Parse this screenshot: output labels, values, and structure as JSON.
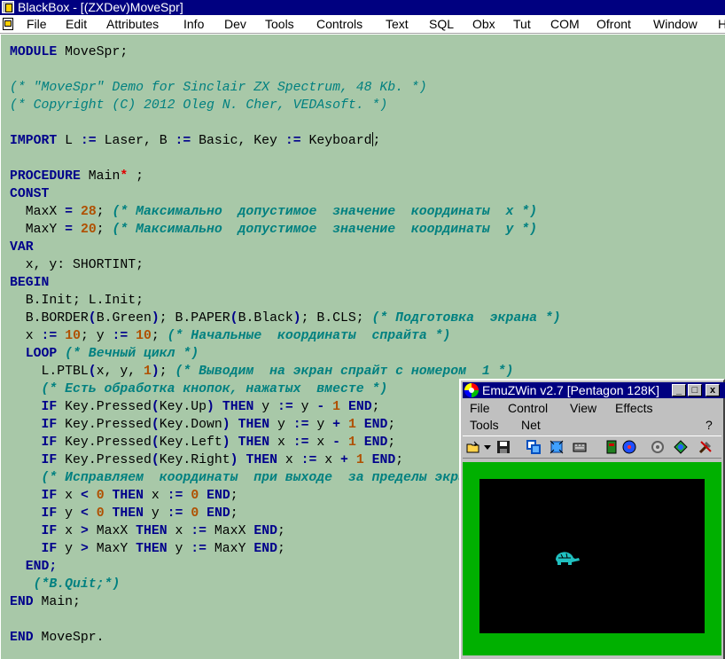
{
  "window": {
    "title": "BlackBox - [(ZXDev)MoveSpr]"
  },
  "menu": [
    "File",
    "Edit",
    "Attributes",
    "Info",
    "Dev",
    "Tools",
    "Controls",
    "Text",
    "SQL",
    "Obx",
    "Tut",
    "COM",
    "Ofront",
    "Window",
    "Help"
  ],
  "code": {
    "l1_kw": "MODULE",
    "l1_rest": " MoveSpr;",
    "c1": "(* \"MoveSpr\" Demo for Sinclair ZX Spectrum, 48 Kb. *)",
    "c2": "(* Copyright (C) 2012 Oleg N. Cher, VEDAsoft. *)",
    "import_kw": "IMPORT",
    "import_rest1": " L ",
    "assign": ":=",
    "import_rest2": " Laser, B ",
    "import_rest3": " Basic, Key ",
    "import_rest4": " Keyboard",
    "import_end": ";",
    "proc_kw": "PROCEDURE",
    "proc_name": " Main",
    "proc_star": "*",
    "proc_end": " ;",
    "const_kw": "CONST",
    "maxx_name": "  MaxX ",
    "eq": "=",
    "maxx_val": "28",
    "maxx_cm": "(* Максимально  допустимое  значение  координаты  x *)",
    "maxy_name": "  MaxY ",
    "maxy_val": "20",
    "maxy_cm": "(* Максимально  допустимое  значение  координаты  y *)",
    "var_kw": "VAR",
    "var_line": "  x, y: SHORTINT;",
    "begin_kw": "BEGIN",
    "init": "  B.Init; L.Init;",
    "border_a": "  B.BORDER",
    "border_b": "(",
    "border_c": "B.Green",
    "border_d": ")",
    "border_e": "; B.PAPER",
    "border_f": "B.Black",
    "border_g": "; B.CLS; ",
    "border_cm": "(* Подготовка  экрана *)",
    "xy_a": "  x ",
    "xy_val1": "10",
    "xy_b": "; y ",
    "xy_val2": "10",
    "xy_cm": "(* Начальные  координаты  спрайта *)",
    "loop_kw": "  LOOP",
    "loop_cm": "(* Вечный цикл *)",
    "ptbl_a": "    L.PTBL",
    "ptbl_b": "x, y, ",
    "ptbl_val": "1",
    "ptbl_cm": "(* Выводим  на экран спрайт с номером  1 *)",
    "c_pressed": "    (* Есть обработка кнопок, нажатых  вместе *)",
    "if_kw": "IF",
    "then_kw": "THEN",
    "end_kw": "END",
    "up_a": " Key.Pressed",
    "up_b": "Key.Up",
    "up_c": " y ",
    "up_d": " y ",
    "minus": "-",
    "plus": "+",
    "one": "1",
    "down_b": "Key.Down",
    "left_b": "Key.Left",
    "right_b": "Key.Right",
    "c_fix": "    (* Исправляем  координаты  при выходе  за пределы экрана *)",
    "lt": "<",
    "gt": ">",
    "zero": "0",
    "maxx": " MaxX ",
    "maxy": " MaxY ",
    "endloop": "  END;",
    "bquit": "   (*B.Quit;*)",
    "end_main": " Main;",
    "end_mod": " MoveSpr."
  },
  "emu": {
    "title": "EmuZWin v2.7 [Pentagon 128K]",
    "menu": [
      "File",
      "Control",
      "View",
      "Effects",
      "Tools",
      "Net",
      "?"
    ],
    "minimize": "_",
    "maximize": "□",
    "close": "x",
    "colors": {
      "border": "#00b000",
      "paper": "#000000",
      "sprite": "#20c0c0"
    },
    "toolbar_icons": [
      "open-icon",
      "dropdown-arrow-icon",
      "save-icon",
      "copy-icon",
      "fullscreen-icon",
      "keyboard-icon",
      "tape-icon",
      "disk-icon",
      "settings-icon",
      "globe-icon",
      "tools-icon"
    ]
  }
}
